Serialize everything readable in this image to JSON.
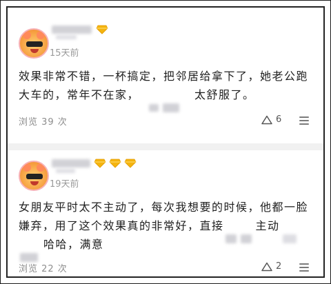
{
  "comments": [
    {
      "time": "15天前",
      "text_line1": "效果非常不错，一杯搞定，把邻居给拿下了，她老公跑",
      "text_line2": "大车的，常年不在家，",
      "text_line2_tail": "太舒服了。",
      "views": "浏览 39 次",
      "likes": "6",
      "badges": 1
    },
    {
      "time": "19天前",
      "text_line1": "女朋友平时太不主动了，每次我想要的时候，他都一脸",
      "text_line2": "嫌弃，用了这个效果真的非常好，直接",
      "text_line2_mid": "主动",
      "text_line3": "哈哈，满意",
      "views": "浏览 22 次",
      "likes": "2",
      "badges": 3
    }
  ],
  "colors": {
    "diamond": "#f4b40f",
    "text": "#1f1f1f",
    "meta": "#9a9a9a"
  },
  "icons": {
    "like": "triangle-like-icon",
    "more": "menu-lines-icon",
    "badge": "diamond-icon"
  }
}
